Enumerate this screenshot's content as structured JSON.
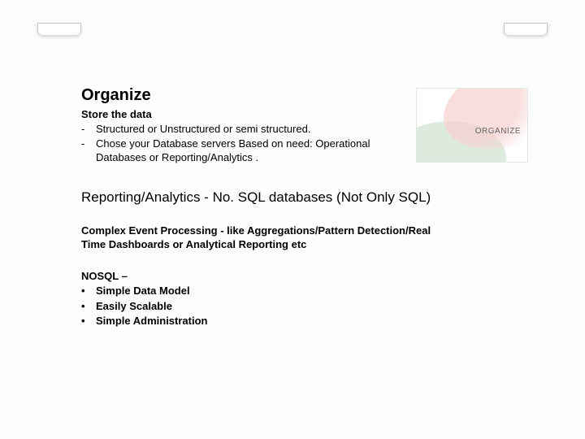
{
  "organize": {
    "heading": "Organize",
    "subtitle": "Store the data",
    "items": [
      "Structured or Unstructured or semi structured.",
      "Chose your Database servers Based on need: Operational Databases or Reporting/Analytics ."
    ]
  },
  "image": {
    "label": "ORGANIZE"
  },
  "section2": "Reporting/Analytics  - No. SQL databases (Not Only SQL)",
  "section3": "Complex Event Processing - like Aggregations/Pattern Detection/Real Time Dashboards or Analytical Reporting etc",
  "nosql": {
    "heading": "NOSQL –",
    "items": [
      "Simple Data Model",
      "Easily  Scalable",
      "Simple Administration"
    ]
  }
}
